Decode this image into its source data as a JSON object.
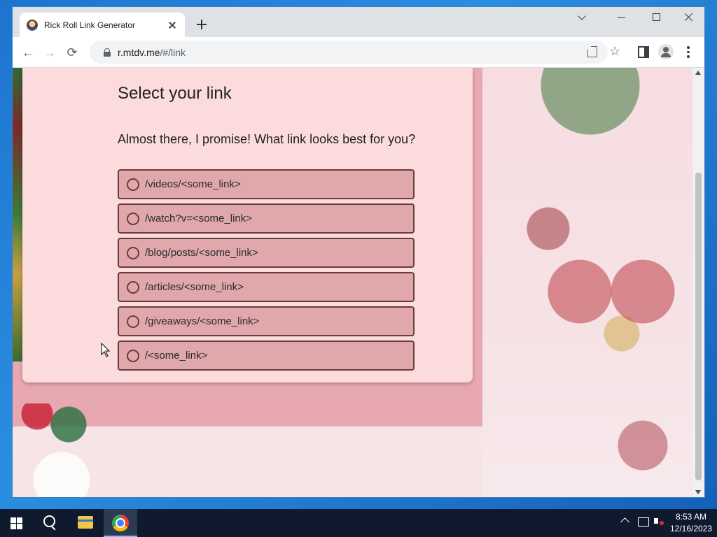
{
  "browser": {
    "tab_title": "Rick Roll Link Generator",
    "url_host": "r.mtdv.me",
    "url_path": "/#/link"
  },
  "page": {
    "title": "Select your link",
    "subtitle": "Almost there, I promise! What link looks best for you?",
    "options": [
      {
        "label": "/videos/<some_link>"
      },
      {
        "label": "/watch?v=<some_link>"
      },
      {
        "label": "/blog/posts/<some_link>"
      },
      {
        "label": "/articles/<some_link>"
      },
      {
        "label": "/giveaways/<some_link>"
      },
      {
        "label": "/<some_link>"
      }
    ]
  },
  "taskbar": {
    "time": "8:53 AM",
    "date": "12/16/2023"
  },
  "colors": {
    "card_bg": "#fcdbdd",
    "option_bg": "#e0a8aa",
    "option_border": "#6b3b3d"
  }
}
